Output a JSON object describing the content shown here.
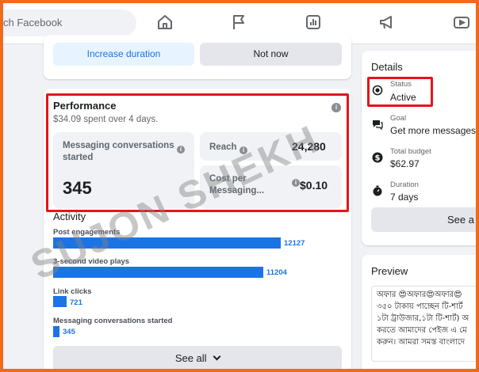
{
  "search": {
    "placeholder_visible": "ch Facebook"
  },
  "nav_icons": [
    "home-icon",
    "flag-icon",
    "insights-icon",
    "megaphone-icon",
    "video-icon"
  ],
  "top_actions": {
    "increase_label": "Increase duration",
    "not_now_label": "Not now"
  },
  "performance": {
    "title": "Performance",
    "spent": "$34.09 spent over 4 days.",
    "messaging_label": "Messaging conversations started",
    "messaging_value": "345",
    "reach_label": "Reach",
    "reach_value": "24,280",
    "cpm_label": "Cost per Messaging...",
    "cpm_value": "$0.10"
  },
  "activity": {
    "title": "Activity",
    "rows": [
      {
        "label": "Post engagements",
        "value": "12127",
        "fraction": 1.0
      },
      {
        "label": "3-second video plays",
        "value": "11204",
        "fraction": 0.924
      },
      {
        "label": "Link clicks",
        "value": "721",
        "fraction": 0.06
      },
      {
        "label": "Messaging conversations started",
        "value": "345",
        "fraction": 0.028
      }
    ],
    "see_all_label": "See all"
  },
  "details": {
    "title": "Details",
    "items": [
      {
        "icon": "radio-icon",
        "small": "Status",
        "value": "Active"
      },
      {
        "icon": "chat-icon",
        "small": "Goal",
        "value": "Get more messages"
      },
      {
        "icon": "dollar-icon",
        "small": "Total budget",
        "value": "$62.97"
      },
      {
        "icon": "stopwatch-icon",
        "small": "Duration",
        "value": "7 days"
      }
    ],
    "see_all_label": "See a"
  },
  "preview": {
    "title": "Preview",
    "lines": [
      "অফার 😍অফার😍অফার😍",
      "৩৫০ টাকায় পাচ্ছেন টি-শার্ট",
      "১টা ট্রাউজার,১টা টি-শার্ট) অ",
      "করতে আমাদের পেইজ এ মে",
      "করুন। আমরা সমস্ত বাংলাদে"
    ]
  },
  "watermark": {
    "text": "SUJON SHEKH"
  },
  "colors": {
    "accent": "#1b74e4",
    "highlight": "#e4151b",
    "frame": "#f06a1d"
  }
}
